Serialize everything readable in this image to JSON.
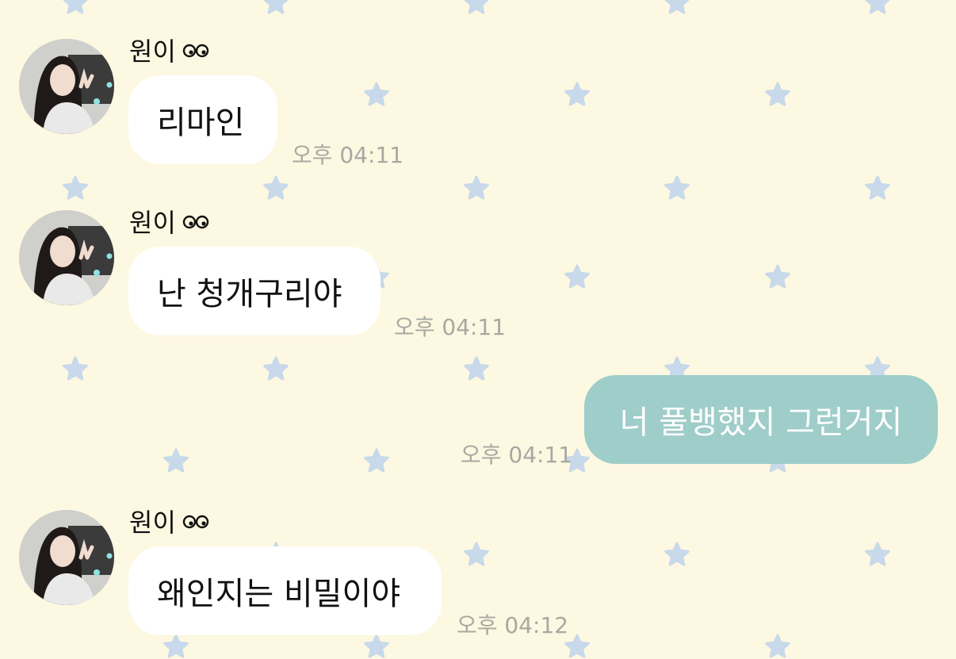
{
  "theme": {
    "background": "#fdf8e1",
    "star_color": "#c7d9ea",
    "incoming_bubble": "#ffffff",
    "outgoing_bubble": "#9fcdc9",
    "timestamp_color": "#a8a8a2"
  },
  "messages": [
    {
      "direction": "incoming",
      "sender": "원이",
      "text": "리마인",
      "time": "오후 04:11"
    },
    {
      "direction": "incoming",
      "sender": "원이",
      "text": "난 청개구리야",
      "time": "오후 04:11"
    },
    {
      "direction": "outgoing",
      "text": "너 풀뱅했지 그런거지",
      "time": "오후 04:11"
    },
    {
      "direction": "incoming",
      "sender": "원이",
      "text": "왜인지는 비밀이야",
      "time": "오후 04:12"
    }
  ]
}
